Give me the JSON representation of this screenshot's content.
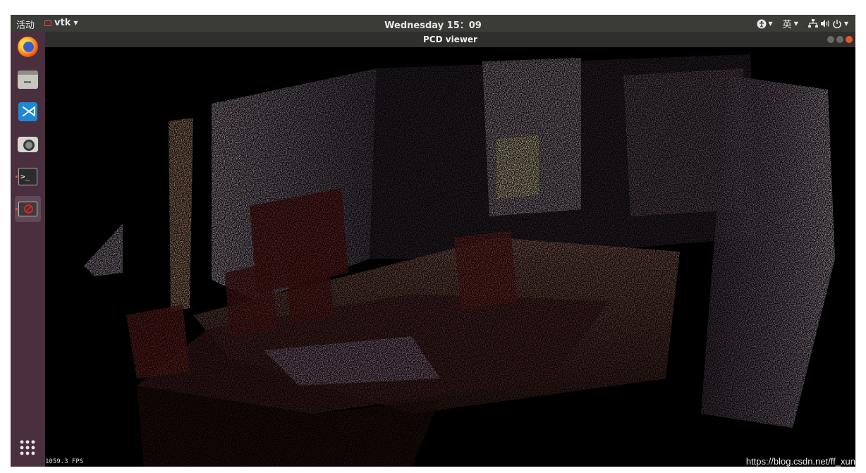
{
  "topbar": {
    "activities": "活动",
    "app_menu": "vtk",
    "clock": "Wednesday 15：09",
    "input_method": "英",
    "tray_icons": [
      "accessibility-icon",
      "network-icon",
      "volume-icon",
      "power-icon"
    ]
  },
  "window": {
    "title": "PCD viewer",
    "controls": [
      "minimize",
      "maximize",
      "close"
    ]
  },
  "dock": {
    "apps": [
      "firefox-icon",
      "files-icon",
      "vscode-icon",
      "camera-icon",
      "terminal-icon",
      "pcd-viewer-icon"
    ],
    "show_apps": "app-grid-icon"
  },
  "viewer": {
    "fps": "1059.3 FPS",
    "background": "#000000"
  },
  "watermark": "https://blog.csdn.net/ff_xun",
  "colors": {
    "topbar": "#3b3b38",
    "dock": "#4a2f3f",
    "accent": "#e95420"
  }
}
